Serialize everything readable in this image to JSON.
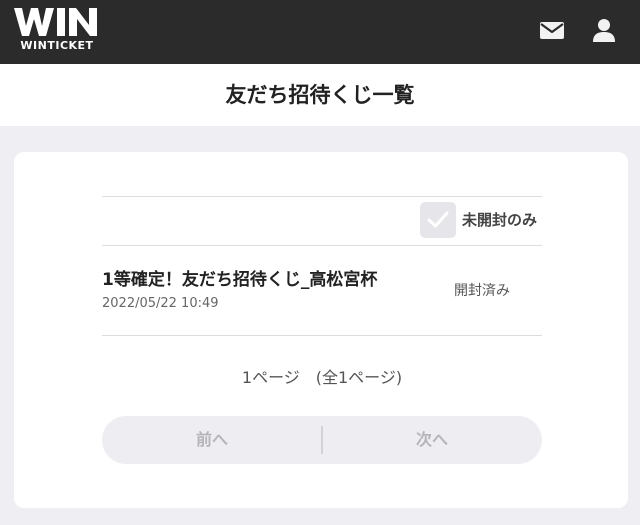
{
  "header": {
    "logo_main": "WIN",
    "logo_sub": "WINTICKET",
    "mail_icon": "mail-icon",
    "user_icon": "user-icon"
  },
  "page": {
    "title": "友だち招待くじ一覧"
  },
  "filter": {
    "label": "未開封のみ",
    "checked": false,
    "icon": "checkmark-icon"
  },
  "list": {
    "items": [
      {
        "title": "1等確定！友だち招待くじ_高松宮杯",
        "date": "2022/05/22 10:49",
        "status": "開封済み"
      }
    ]
  },
  "pagination": {
    "info": "1ページ　(全1ページ)",
    "prev_label": "前へ",
    "next_label": "次へ"
  },
  "colors": {
    "header_bg": "#2b2b2b",
    "page_bg": "#efeff3",
    "disabled_text": "#b4b4ba"
  }
}
